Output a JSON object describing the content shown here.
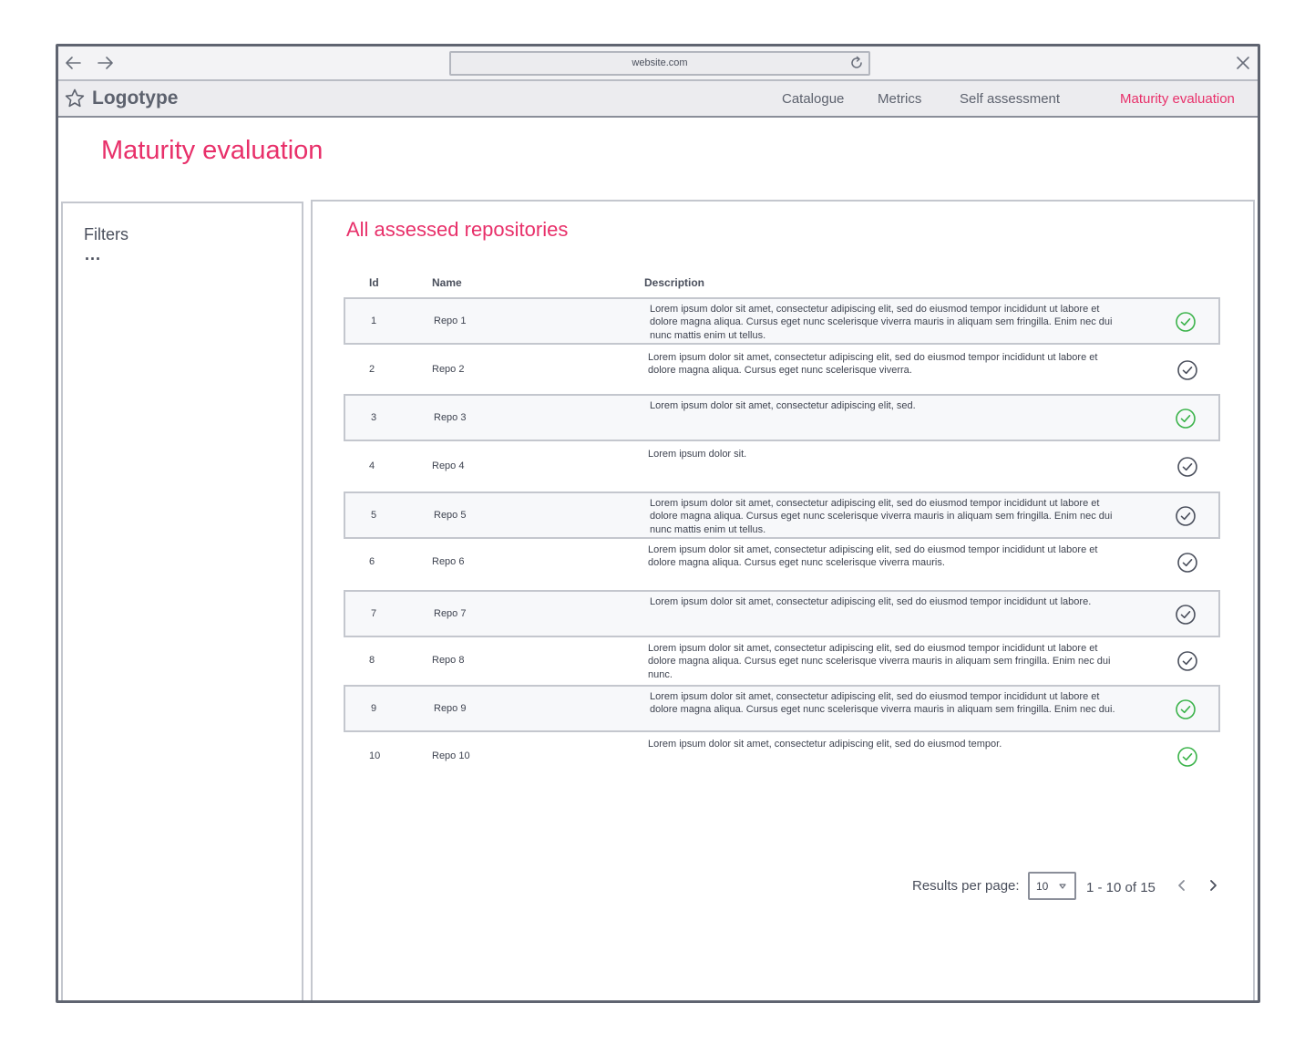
{
  "browser": {
    "url": "website.com"
  },
  "header": {
    "logo": "Logotype",
    "nav": [
      "Catalogue",
      "Metrics",
      "Self assessment",
      "Maturity evaluation"
    ],
    "active_nav": "Maturity evaluation"
  },
  "page": {
    "title": "Maturity evaluation"
  },
  "filters": {
    "title": "Filters",
    "more": "..."
  },
  "table": {
    "title": "All assessed repositories",
    "columns": [
      "Id",
      "Name",
      "Description"
    ],
    "rows": [
      {
        "id": "1",
        "name": "Repo 1",
        "description": "Lorem ipsum dolor sit amet, consectetur adipiscing elit, sed do eiusmod tempor incididunt ut labore et dolore magna aliqua. Cursus eget nunc scelerisque viverra mauris in aliquam sem fringilla. Enim nec dui nunc mattis enim ut tellus.",
        "status": "green"
      },
      {
        "id": "2",
        "name": "Repo 2",
        "description": "Lorem ipsum dolor sit amet, consectetur adipiscing elit, sed do eiusmod tempor incididunt ut labore et dolore magna aliqua. Cursus eget nunc scelerisque viverra.",
        "status": "gray"
      },
      {
        "id": "3",
        "name": "Repo 3",
        "description": "Lorem ipsum dolor sit amet, consectetur adipiscing elit, sed.",
        "status": "green"
      },
      {
        "id": "4",
        "name": "Repo 4",
        "description": "Lorem ipsum dolor sit.",
        "status": "gray"
      },
      {
        "id": "5",
        "name": "Repo 5",
        "description": "Lorem ipsum dolor sit amet, consectetur adipiscing elit, sed do eiusmod tempor incididunt ut labore et dolore magna aliqua. Cursus eget nunc scelerisque viverra mauris in aliquam sem fringilla. Enim nec dui nunc mattis enim ut tellus.",
        "status": "gray"
      },
      {
        "id": "6",
        "name": "Repo 6",
        "description": "Lorem ipsum dolor sit amet, consectetur adipiscing elit, sed do eiusmod tempor incididunt ut labore et dolore magna aliqua. Cursus eget nunc scelerisque viverra mauris.",
        "status": "gray"
      },
      {
        "id": "7",
        "name": "Repo 7",
        "description": "Lorem ipsum dolor sit amet, consectetur adipiscing elit, sed do eiusmod tempor incididunt ut labore.",
        "status": "gray"
      },
      {
        "id": "8",
        "name": "Repo 8",
        "description": "Lorem ipsum dolor sit amet, consectetur adipiscing elit, sed do eiusmod tempor incididunt ut labore et dolore magna aliqua. Cursus eget nunc scelerisque viverra mauris in aliquam sem fringilla. Enim nec dui nunc.",
        "status": "gray"
      },
      {
        "id": "9",
        "name": "Repo 9",
        "description": "Lorem ipsum dolor sit amet, consectetur adipiscing elit, sed do eiusmod tempor incididunt ut labore et dolore magna aliqua. Cursus eget nunc scelerisque viverra mauris in aliquam sem fringilla. Enim nec dui.",
        "status": "green"
      },
      {
        "id": "10",
        "name": "Repo 10",
        "description": "Lorem ipsum dolor sit amet, consectetur adipiscing elit, sed do eiusmod tempor.",
        "status": "green"
      }
    ]
  },
  "pagination": {
    "results_label": "Results per page:",
    "per_page": "10",
    "range": "1 - 10 of 15"
  },
  "icons": {
    "back": "arrow-left-icon",
    "forward": "arrow-right-icon",
    "reload": "reload-icon",
    "close": "close-icon",
    "logo": "star-icon",
    "status": "check-circle-icon",
    "caret": "caret-down-icon",
    "prev": "chevron-left-icon",
    "next": "chevron-right-icon"
  },
  "colors": {
    "accent": "#e8306a",
    "status_green": "#3bb34a",
    "status_gray": "#4a4f5c"
  }
}
